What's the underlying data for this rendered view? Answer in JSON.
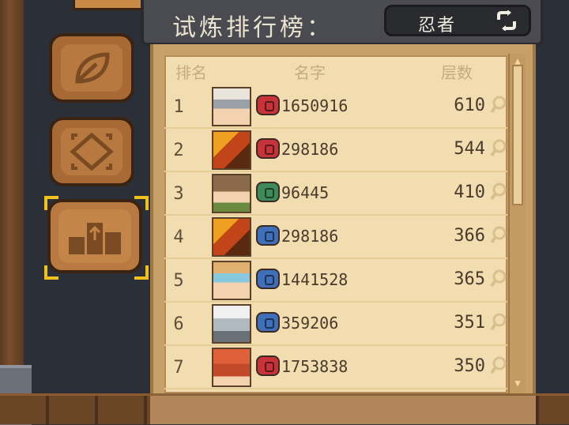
{
  "header": {
    "title": "试炼排行榜：",
    "mode_label": "忍者"
  },
  "columns": {
    "rank": "排名",
    "name": "名字",
    "floors": "层数"
  },
  "side_tabs": [
    {
      "id": "leaf",
      "icon": "leaf-icon"
    },
    {
      "id": "diamond",
      "icon": "diamond-icon"
    },
    {
      "id": "ranking",
      "icon": "podium-icon",
      "selected": true
    }
  ],
  "rows": [
    {
      "rank": "1",
      "player_id": "1650916",
      "floors": "610",
      "badge": "red"
    },
    {
      "rank": "2",
      "player_id": "298186",
      "floors": "544",
      "badge": "red"
    },
    {
      "rank": "3",
      "player_id": "96445",
      "floors": "410",
      "badge": "green"
    },
    {
      "rank": "4",
      "player_id": "298186",
      "floors": "366",
      "badge": "blue"
    },
    {
      "rank": "5",
      "player_id": "1441528",
      "floors": "365",
      "badge": "blue"
    },
    {
      "rank": "6",
      "player_id": "359206",
      "floors": "351",
      "badge": "blue"
    },
    {
      "rank": "7",
      "player_id": "1753838",
      "floors": "350",
      "badge": "red"
    }
  ],
  "colors": {
    "badge_red": "#c7333a",
    "badge_green": "#3e8a5a",
    "badge_blue": "#3f6fb8",
    "panel_bg": "#f1ddb0",
    "selected_corner": "#f2c21c"
  }
}
